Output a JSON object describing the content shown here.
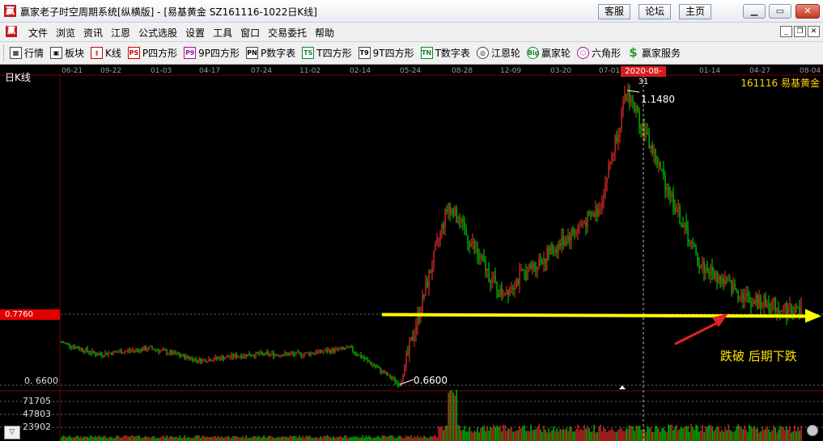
{
  "window": {
    "title": "赢家老子时空周期系统[纵横版] - [易基黄金  SZ161116-1022日K线]",
    "logo_char": "赢",
    "top_buttons": [
      "客服",
      "论坛",
      "主页"
    ],
    "controls": [
      "minimize",
      "maximize",
      "close"
    ]
  },
  "menu": {
    "items": [
      "文件",
      "浏览",
      "资讯",
      "江恩",
      "公式选股",
      "设置",
      "工具",
      "窗口",
      "交易委托",
      "帮助"
    ]
  },
  "toolbar": {
    "items": [
      {
        "label": "行情",
        "icon": "grid-icon",
        "glyph": "▦"
      },
      {
        "label": "板块",
        "icon": "blocks-icon",
        "glyph": "▣"
      },
      {
        "label": "K线",
        "icon": "candlestick-icon",
        "glyph": "⫾"
      },
      {
        "label": "P四方形",
        "icon": "ps-icon",
        "glyph": "PS"
      },
      {
        "label": "9P四方形",
        "icon": "p9-icon",
        "glyph": "P9"
      },
      {
        "label": "P数字表",
        "icon": "pn-icon",
        "glyph": "PN"
      },
      {
        "label": "T四方形",
        "icon": "ts-icon",
        "glyph": "TS"
      },
      {
        "label": "9T四方形",
        "icon": "t9-icon",
        "glyph": "T9"
      },
      {
        "label": "T数字表",
        "icon": "tn-icon",
        "glyph": "TN"
      },
      {
        "label": "江恩轮",
        "icon": "gann-wheel-icon",
        "glyph": "◎"
      },
      {
        "label": "赢家轮",
        "icon": "big-wheel-icon",
        "glyph": "Big"
      },
      {
        "label": "六角形",
        "icon": "hexagon-icon",
        "glyph": "⬡"
      },
      {
        "label": "赢家服务",
        "icon": "dollar-icon",
        "glyph": "$"
      }
    ]
  },
  "chart": {
    "period_label": "日K线",
    "security": "161116  易基黄金",
    "date_ticks": [
      "06-21",
      "09-22",
      "01-03",
      "04-17",
      "07-24",
      "11-02",
      "02-14",
      "05-24",
      "08-28",
      "12-09",
      "03-20",
      "07-01",
      "2020-08-31",
      "01-14",
      "04-27",
      "08-04"
    ],
    "highlight_date": "2020-08-31",
    "current_price": "0.7760",
    "axis_low": "0. 6600",
    "high_mark": "1.1480",
    "low_mark": "0.6600",
    "volume_ticks": [
      "71705",
      "47803",
      "23902"
    ],
    "annotation": "跌破  后期下跌",
    "colors": {
      "up": "#ff3030",
      "down": "#00e000",
      "support_line": "#ffff00",
      "arrow": "#e52222",
      "grid": "#7a0000"
    }
  },
  "chart_data": {
    "type": "candlestick",
    "title": "日K线",
    "series_name": "161116  易基黄金",
    "x_ticks": [
      "06-21",
      "09-22",
      "01-03",
      "04-17",
      "07-24",
      "11-02",
      "02-14",
      "05-24",
      "08-28",
      "12-09",
      "03-20",
      "07-01",
      "2020-08-31",
      "01-14",
      "04-27",
      "08-04"
    ],
    "close_trend": [
      {
        "date": "06-21",
        "value": 0.73
      },
      {
        "date": "09-22",
        "value": 0.71
      },
      {
        "date": "01-03",
        "value": 0.72
      },
      {
        "date": "04-17",
        "value": 0.7
      },
      {
        "date": "07-24",
        "value": 0.71
      },
      {
        "date": "11-02",
        "value": 0.71
      },
      {
        "date": "02-14",
        "value": 0.72
      },
      {
        "date": "05-24",
        "value": 0.66
      },
      {
        "date": "08-28",
        "value": 0.96
      },
      {
        "date": "12-09",
        "value": 0.81
      },
      {
        "date": "03-20",
        "value": 0.88
      },
      {
        "date": "07-01",
        "value": 0.95
      },
      {
        "date": "2020-08-31",
        "value": 1.148
      },
      {
        "date": "01-14",
        "value": 0.86
      },
      {
        "date": "04-27",
        "value": 0.8
      },
      {
        "date": "08-04",
        "value": 0.78
      }
    ],
    "high": 1.148,
    "low": 0.66,
    "reference_line": 0.776,
    "volume_ticks": [
      71705,
      47803,
      23902
    ],
    "annotation": "跌破  后期下跌"
  }
}
